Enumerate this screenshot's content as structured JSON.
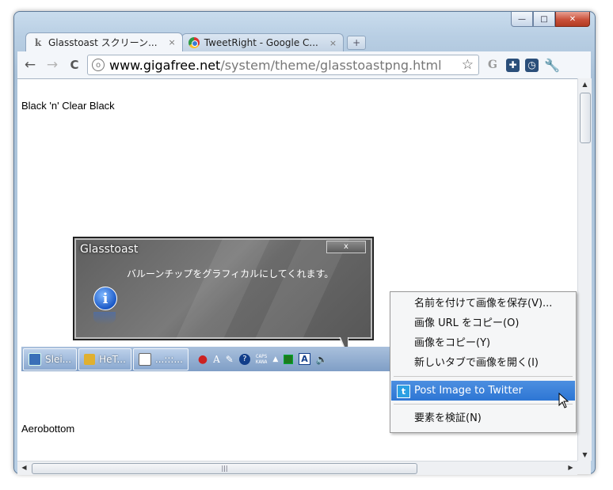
{
  "window": {
    "controls": {
      "minimize": "—",
      "maximize": "□",
      "close": "✕"
    }
  },
  "tabs": [
    {
      "label": "Glasstoast スクリーン...",
      "close": "×",
      "icon": "k-logo-icon",
      "active": true
    },
    {
      "label": "TweetRight - Google C...",
      "close": "×",
      "icon": "chrome-icon",
      "active": false
    }
  ],
  "new_tab": "+",
  "toolbar": {
    "back": "←",
    "forward": "→",
    "reload": "C",
    "url_host": "www.gigafree.net",
    "url_path": "/system/theme/glasstoastpng.html",
    "star": "☆",
    "extensions": [
      "G",
      "✚",
      "◷",
      "🔧"
    ]
  },
  "page": {
    "text_top": "Black 'n' Clear Black",
    "text_bottom": "Aerobottom"
  },
  "balloon": {
    "title": "Glasstoast",
    "close": "x",
    "message": "バルーンチップをグラフィカルにしてくれます。",
    "icon": "i"
  },
  "taskbar": {
    "buttons": [
      "Slei...",
      "HeT...",
      "...:::..."
    ],
    "tray_caps": "CAPS",
    "tray_kana": "KANA"
  },
  "context_menu": {
    "items": [
      "名前を付けて画像を保存(V)...",
      "画像 URL をコピー(O)",
      "画像をコピー(Y)",
      "新しいタブで画像を開く(I)",
      "Post Image to Twitter",
      "要素を検証(N)"
    ],
    "highlighted_index": 4
  },
  "colors": {
    "menu_highlight": "#2d76d4",
    "frame": "#b9cfe4",
    "balloon": "#6b6b6b"
  }
}
